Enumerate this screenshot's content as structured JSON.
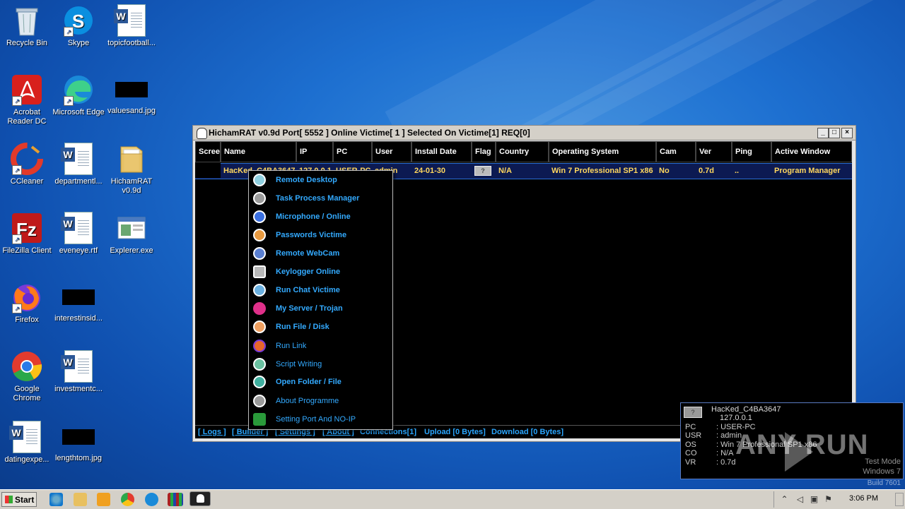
{
  "desktop": {
    "icons": [
      {
        "label": "Recycle Bin"
      },
      {
        "label": "Skype"
      },
      {
        "label": "topicfootball..."
      },
      {
        "label": "Acrobat Reader DC"
      },
      {
        "label": "Microsoft Edge"
      },
      {
        "label": "valuesand.jpg"
      },
      {
        "label": "CCleaner"
      },
      {
        "label": "departmentl..."
      },
      {
        "label": "HichamRAT v0.9d"
      },
      {
        "label": "FileZilla Client"
      },
      {
        "label": "eveneye.rtf"
      },
      {
        "label": "Explerer.exe"
      },
      {
        "label": "Firefox"
      },
      {
        "label": "interestinsid..."
      },
      {
        "label": "Google Chrome"
      },
      {
        "label": "investmentc..."
      },
      {
        "label": "datingexpe..."
      },
      {
        "label": "lengthtom.jpg"
      }
    ]
  },
  "window": {
    "title": "HichamRAT v0.9d   Port[ 5552 ]   Online Victime[ 1 ]   Selected On Victime[1] REQ[0]",
    "minimize": "_",
    "maximize": "□",
    "close": "×",
    "columns": [
      "Scree",
      "Name",
      "IP",
      "PC",
      "User",
      "Install Date",
      "Flag",
      "Country",
      "Operating System",
      "Cam",
      "Ver",
      "Ping",
      "Active Window"
    ],
    "row": {
      "name": "HacKed_C4BA3647",
      "ip": "127.0.0.1",
      "pc": "USER-PC",
      "user": "admin",
      "install_date": "24-01-30",
      "flag": "?",
      "country": "N/A",
      "os": "Win 7 Professional SP1 x86",
      "cam": "No",
      "ver": "0.7d",
      "ping": "..",
      "active_window": "Program Manager"
    },
    "status": {
      "logs": "[ Logs ]",
      "builder": "[ Builder ]",
      "settings": "[ Settings ]",
      "about": "[ About ]",
      "connections": "Connections[1]",
      "upload": "Upload [0 Bytes]",
      "download": "Download [0 Bytes]"
    }
  },
  "context_menu": {
    "items": [
      {
        "label": "Remote Desktop",
        "icon": "monitor-icon",
        "color": "#8fd0e0"
      },
      {
        "label": "Task Process Manager",
        "icon": "gears-icon",
        "color": "#9a9a9a"
      },
      {
        "label": "Microphone / Online",
        "icon": "microphone-icon",
        "color": "#3a6fe0"
      },
      {
        "label": "Passwords Victime",
        "icon": "lock-icon",
        "color": "#e89a40"
      },
      {
        "label": "Remote WebCam",
        "icon": "webcam-icon",
        "color": "#5a7fd0"
      },
      {
        "label": "Keylogger Online",
        "icon": "keyboard-icon",
        "color": "#b8b8b8"
      },
      {
        "label": "Run Chat Victime",
        "icon": "chat-icon",
        "color": "#6ab0e0"
      },
      {
        "label": "My Server / Trojan",
        "icon": "virus-icon",
        "color": "#e0308a"
      },
      {
        "label": "Run File / Disk",
        "icon": "file-icon",
        "color": "#f0a060"
      },
      {
        "label": "Run Link",
        "icon": "firefox-icon",
        "color": "#e8662a"
      },
      {
        "label": "Script Writing",
        "icon": "script-icon",
        "color": "#6ac0a0"
      },
      {
        "label": "Open Folder / File",
        "icon": "folder-tools-icon",
        "color": "#40b0a0"
      },
      {
        "label": "About Programme",
        "icon": "user-icon",
        "color": "#9a9a9a"
      },
      {
        "label": "Setting Port And NO-IP",
        "icon": "shield-check-icon",
        "color": "#2a9a3a"
      }
    ]
  },
  "notification": {
    "flag": "?",
    "name": "HacKed_C4BA3647",
    "ip": "127.0.0.1",
    "rows": [
      {
        "key": "PC",
        "value": ": USER-PC"
      },
      {
        "key": "USR",
        "value": ": admin"
      },
      {
        "key": "OS",
        "value": ": Win 7 Professional SP1 x86"
      },
      {
        "key": "CO",
        "value": ": N/A"
      },
      {
        "key": "VR",
        "value": ": 0.7d"
      }
    ]
  },
  "watermark": {
    "brand": "ANY  RUN",
    "test_mode": "Test Mode",
    "windows": "Windows 7",
    "build": "Build 7601"
  },
  "taskbar": {
    "start": "Start",
    "clock": "3:06 PM"
  }
}
